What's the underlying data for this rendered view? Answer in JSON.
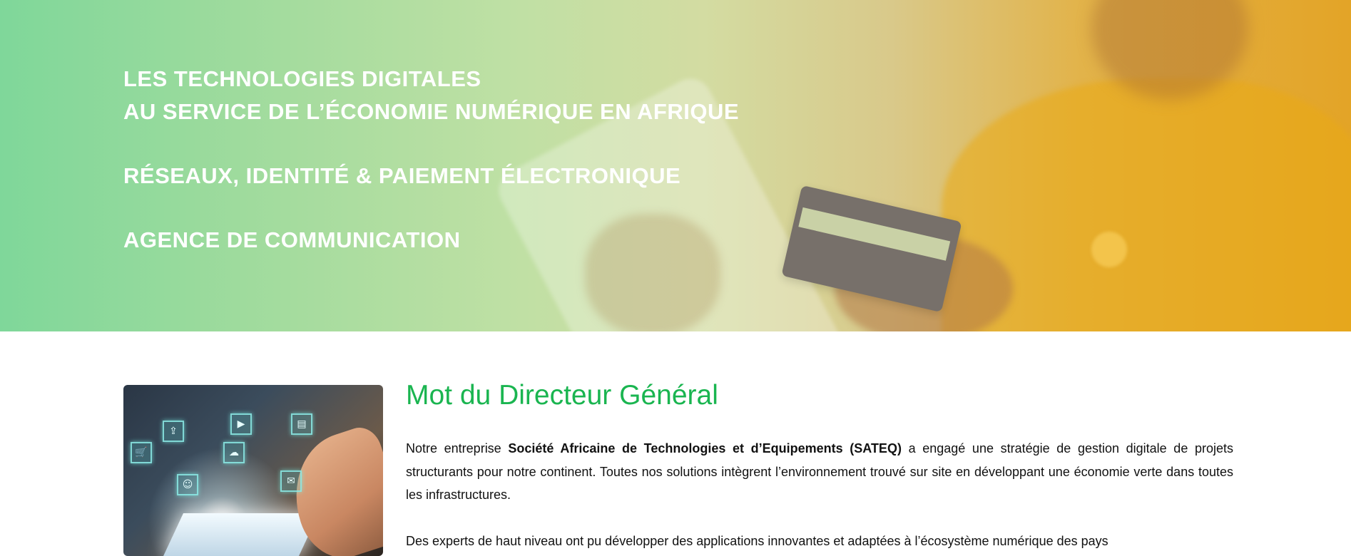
{
  "hero": {
    "lines": [
      "LES TECHNOLOGIES DIGITALES",
      "AU SERVICE DE L’ÉCONOMIE NUMÉRIQUE EN AFRIQUE",
      "RÉSEAUX, IDENTITÉ & PAIEMENT ÉLECTRONIQUE",
      "AGENCE DE COMMUNICATION"
    ]
  },
  "content": {
    "title": "Mot du Directeur Général",
    "paragraph1": {
      "prefix": "Notre entreprise ",
      "company": "Société Africaine de Technologies et d’Equipements (SATEQ)",
      "suffix": " a engagé une stratégie de gestion digitale de projets structurants pour notre continent. Toutes nos solutions intègrent l’environnement trouvé sur site en développant une économie verte dans toutes les infrastructures."
    },
    "paragraph2": "Des experts de haut niveau ont pu développer des applications innovantes et adaptées à l’écosystème numérique des pays"
  },
  "image_icons": [
    "cart-icon",
    "upload-icon",
    "play-icon",
    "cloud-icon",
    "user-icon",
    "mail-icon",
    "chart-icon"
  ],
  "colors": {
    "title_green": "#1ab550",
    "hero_gradient_start": "#7fd79a",
    "hero_gradient_end": "#e3a427"
  }
}
